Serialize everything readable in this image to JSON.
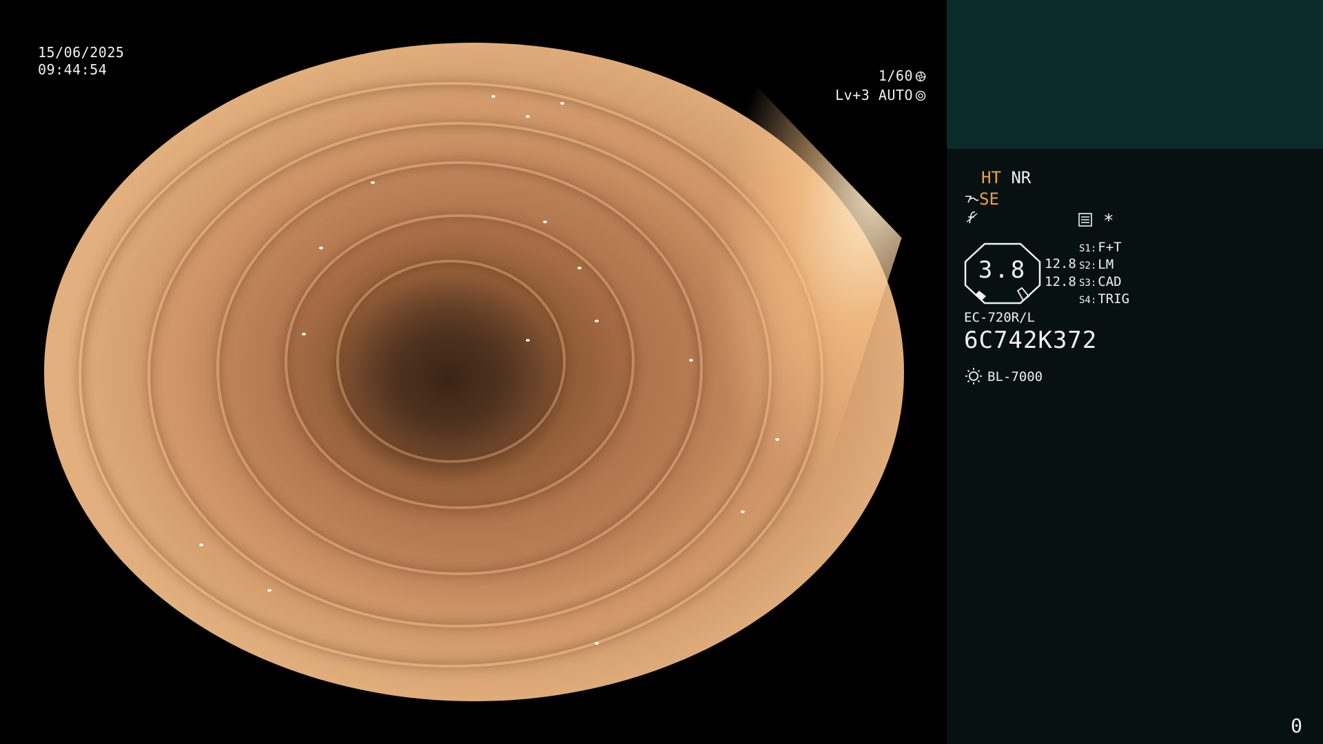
{
  "video": {
    "date": "15/06/2025",
    "time": "09:44:54",
    "shutter": "1/60",
    "shutter_icon": "aperture-icon",
    "level": "Lv+3 AUTO",
    "level_icon": "iris-icon"
  },
  "panel": {
    "ht": "HT",
    "nr": "NR",
    "se": "SE",
    "se_icon": "enhance-icon",
    "f_icon": "f-slash-icon",
    "menu_icon": "menu-list-icon",
    "asterisk": "*",
    "gauge_value": "3.8",
    "val_top": "12.8",
    "val_bottom": "12.8",
    "switches": [
      {
        "label": "S1:",
        "value": "F+T"
      },
      {
        "label": "S2:",
        "value": "LM"
      },
      {
        "label": "S3:",
        "value": "CAD"
      },
      {
        "label": "S4:",
        "value": "TRIG"
      }
    ],
    "model": "EC-720R/L",
    "serial": "6C742K372",
    "light_icon": "light-source-icon",
    "light_source": "BL-7000",
    "counter": "0"
  },
  "colors": {
    "accent": "#f0a23c",
    "panel_bg": "#081111",
    "panel_top": "#0b2a2a"
  }
}
